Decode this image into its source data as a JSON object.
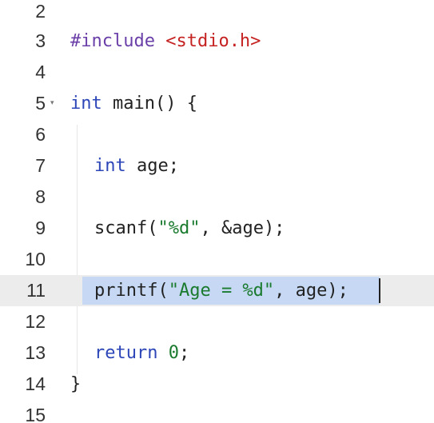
{
  "editor": {
    "lines": [
      {
        "number": "2"
      },
      {
        "number": "3",
        "tokens": [
          "#include",
          " ",
          "<stdio.h>"
        ]
      },
      {
        "number": "4"
      },
      {
        "number": "5",
        "fold": "▾",
        "tokens": [
          "int",
          " main() {"
        ]
      },
      {
        "number": "6"
      },
      {
        "number": "7",
        "tokens": [
          "int",
          " age;"
        ]
      },
      {
        "number": "8"
      },
      {
        "number": "9",
        "tokens": [
          "scanf(",
          "\"%d\"",
          ", &age);"
        ]
      },
      {
        "number": "10"
      },
      {
        "number": "11",
        "tokens": [
          "printf(",
          "\"Age = %d\"",
          ", age);"
        ]
      },
      {
        "number": "12"
      },
      {
        "number": "13",
        "tokens": [
          "return",
          " ",
          "0",
          ";"
        ]
      },
      {
        "number": "14",
        "tokens": [
          "}"
        ]
      },
      {
        "number": "15"
      }
    ],
    "active_line": "11",
    "selected_text": "printf(\"Age = %d\", age);"
  },
  "colors": {
    "keyword": "#2d46b8",
    "preprocessor": "#6a3fa8",
    "header": "#c52222",
    "string": "#1a7a2e",
    "selection": "#c6d8f3",
    "active_line": "#ececec"
  }
}
